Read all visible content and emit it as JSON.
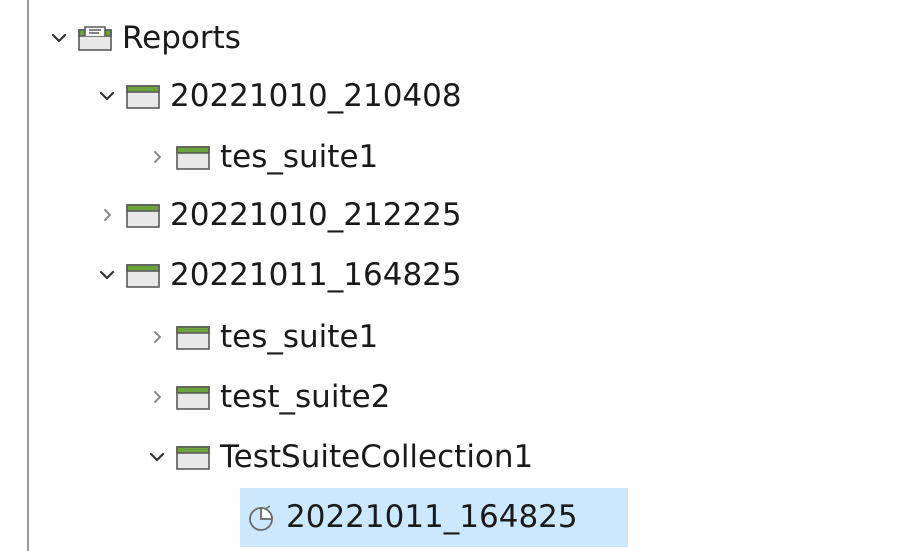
{
  "tree": {
    "root": {
      "label": "Reports",
      "expanded": true,
      "icon": "reports-folder-icon"
    },
    "report_1": {
      "label": "20221010_210408",
      "expanded": true,
      "icon": "folder-icon"
    },
    "report_1_child_1": {
      "label": "tes_suite1",
      "expanded": false,
      "icon": "folder-icon"
    },
    "report_2": {
      "label": "20221010_212225",
      "expanded": false,
      "icon": "folder-icon"
    },
    "report_3": {
      "label": "20221011_164825",
      "expanded": true,
      "icon": "folder-icon"
    },
    "report_3_child_1": {
      "label": "tes_suite1",
      "expanded": false,
      "icon": "folder-icon"
    },
    "report_3_child_2": {
      "label": "test_suite2",
      "expanded": false,
      "icon": "folder-icon"
    },
    "report_3_child_3": {
      "label": "TestSuiteCollection1",
      "expanded": true,
      "icon": "folder-icon"
    },
    "report_3_child_3_item_1": {
      "label": "20221011_164825",
      "selected": true,
      "icon": "report-run-icon"
    }
  },
  "colors": {
    "selection": "#cce8ff",
    "folder_tab": "#6aa43a",
    "folder_body": "#e8e8e8",
    "folder_outline": "#5a5a5a",
    "border": "#9a9a9a"
  }
}
